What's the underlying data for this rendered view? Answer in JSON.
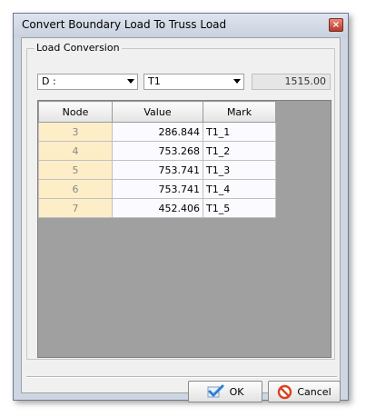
{
  "window": {
    "title": "Convert Boundary Load To Truss Load",
    "close_glyph": "×"
  },
  "group": {
    "label": "Load Conversion"
  },
  "combos": {
    "load_case": "D :",
    "truss": "T1"
  },
  "total_value": "1515.00",
  "table": {
    "headers": [
      "Node",
      "Value",
      "Mark"
    ],
    "rows": [
      {
        "node": "3",
        "value": "286.844",
        "mark": "T1_1"
      },
      {
        "node": "4",
        "value": "753.268",
        "mark": "T1_2"
      },
      {
        "node": "5",
        "value": "753.741",
        "mark": "T1_3"
      },
      {
        "node": "6",
        "value": "753.741",
        "mark": "T1_4"
      },
      {
        "node": "7",
        "value": "452.406",
        "mark": "T1_5"
      }
    ]
  },
  "buttons": {
    "ok": "OK",
    "cancel": "Cancel"
  },
  "icons": {
    "ok": "checkmark-icon",
    "cancel": "no-sign-icon"
  },
  "colors": {
    "node_cell": "#fdeec8",
    "grid_bg": "#a0a0a0",
    "cancel_icon": "#d9431e",
    "ok_icon": "#2f7fd3"
  }
}
